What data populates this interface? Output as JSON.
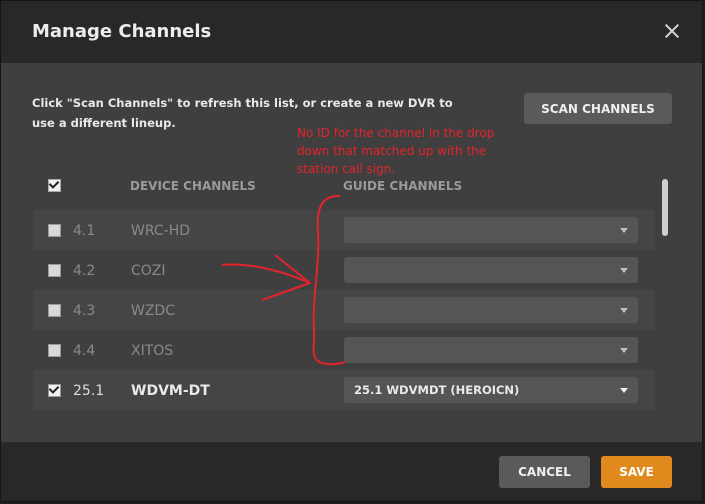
{
  "dialog": {
    "title": "Manage Channels",
    "description": "Click \"Scan Channels\" to refresh this list, or create a new DVR to use a different lineup.",
    "scan_label": "SCAN CHANNELS",
    "cancel_label": "CANCEL",
    "save_label": "SAVE"
  },
  "table": {
    "header_device": "DEVICE CHANNELS",
    "header_guide": "GUIDE CHANNELS",
    "rows": [
      {
        "number": "4.1",
        "name": "WRC-HD",
        "guide": "",
        "checked": false
      },
      {
        "number": "4.2",
        "name": "COZI",
        "guide": "",
        "checked": false
      },
      {
        "number": "4.3",
        "name": "WZDC",
        "guide": "",
        "checked": false
      },
      {
        "number": "4.4",
        "name": "XITOS",
        "guide": "",
        "checked": false
      },
      {
        "number": "25.1",
        "name": "WDVM-DT",
        "guide": "25.1 WDVMDT (HEROICN)",
        "checked": true
      }
    ]
  },
  "annotation": {
    "text": "No ID for the channel in the drop down that matched up with the station call sign.",
    "color": "#e3242b"
  },
  "colors": {
    "save_accent": "#e08a1e",
    "dialog_bg": "#3f3f3f",
    "header_bg": "#282828"
  },
  "icons": {
    "close": "close-icon",
    "dropdown": "chevron-down-icon"
  }
}
